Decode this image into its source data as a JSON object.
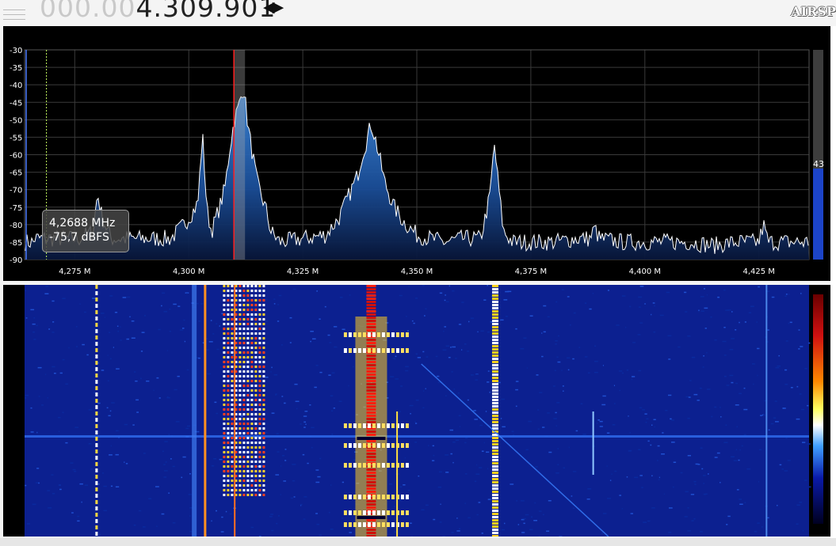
{
  "header": {
    "frequency_dim": "000.00",
    "frequency_bright": "4.309.901",
    "step_arrows": "◀▶",
    "logo_text": "AIRSP"
  },
  "spectrum": {
    "y_ticks": [
      "-30",
      "-35",
      "-40",
      "-45",
      "-50",
      "-55",
      "-60",
      "-65",
      "-70",
      "-75",
      "-80",
      "-85",
      "-90"
    ],
    "x_ticks": [
      "4,275 M",
      "4,300 M",
      "4,325 M",
      "4,350 M",
      "4,375 M",
      "4,400 M",
      "4,425 M"
    ],
    "cursor_tooltip": {
      "frequency": "4,2688 MHz",
      "level": "-75,7 dBFS"
    },
    "level_meter_value": "43",
    "colors": {
      "trace": "#ffffff",
      "fill_top": "#2a6fc0",
      "fill_bottom": "#0a1a40",
      "grid": "#3c3c3c",
      "vfo_marker": "#ff2020",
      "meter_fill": "#1c44c8"
    }
  },
  "chart_data": {
    "type": "line",
    "x_unit": "MHz",
    "y_unit": "dBFS",
    "xlim": [
      4.264,
      4.436
    ],
    "ylim": [
      -90,
      -30
    ],
    "series": [
      {
        "x": [
          4.266,
          4.272,
          4.276,
          4.279,
          4.28,
          4.281,
          4.283,
          4.29,
          4.296,
          4.299,
          4.301,
          4.302,
          4.303,
          4.304,
          4.305,
          4.307,
          4.308,
          4.309,
          4.31,
          4.311,
          4.312,
          4.313,
          4.314,
          4.315,
          4.317,
          4.318,
          4.32,
          4.325,
          4.33,
          4.333,
          4.335,
          4.337,
          4.338,
          4.339,
          4.34,
          4.341,
          4.342,
          4.343,
          4.345,
          4.347,
          4.35,
          4.353,
          4.356,
          4.36,
          4.364,
          4.366,
          4.367,
          4.368,
          4.369,
          4.371,
          4.375,
          4.38,
          4.385,
          4.388,
          4.389,
          4.39,
          4.395,
          4.4,
          4.405,
          4.41,
          4.415,
          4.42,
          4.425,
          4.426,
          4.427,
          4.43,
          4.435
        ],
        "y": [
          -84,
          -84,
          -84,
          -82,
          -71,
          -78,
          -84,
          -84,
          -84,
          -80,
          -76,
          -74,
          -54,
          -76,
          -82,
          -74,
          -69,
          -58,
          -50,
          -46,
          -40,
          -52,
          -60,
          -68,
          -76,
          -82,
          -85,
          -84,
          -83,
          -78,
          -72,
          -66,
          -60,
          -56,
          -51,
          -56,
          -62,
          -68,
          -75,
          -79,
          -83,
          -84,
          -85,
          -84,
          -84,
          -72,
          -57,
          -70,
          -82,
          -85,
          -85,
          -85,
          -84,
          -84,
          -81,
          -84,
          -85,
          -85,
          -85,
          -85,
          -86,
          -85,
          -85,
          -80,
          -85,
          -85,
          -85
        ]
      }
    ]
  }
}
